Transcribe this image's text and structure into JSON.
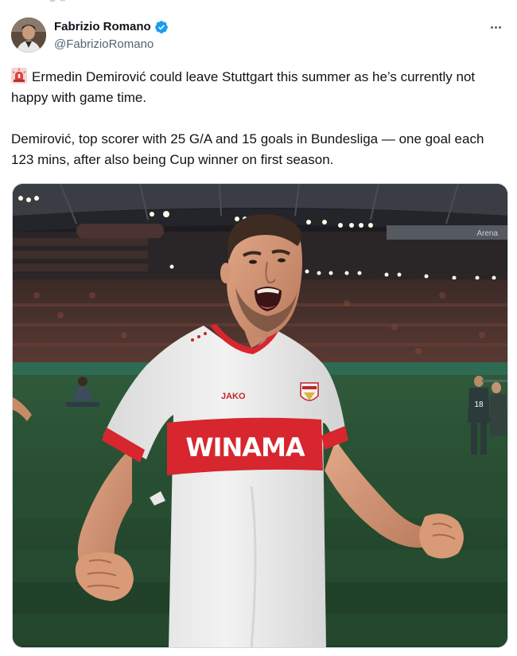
{
  "tweet": {
    "author": {
      "name": "Fabrizio Romano",
      "handle": "@FabrizioRomano",
      "verified": true,
      "avatar_icon": "avatar-photo"
    },
    "more_icon": "more-dots-icon",
    "paragraphs": [
      {
        "emoji": "rotating-light-icon",
        "text": "Ermedin Demirović could leave Stuttgart this summer as he’s currently not happy with game time."
      },
      {
        "text": "Demirović, top scorer with 25 G/A and 15 goals in Bundesliga — one goal each 123 mins, after also being Cup winner on first season."
      }
    ],
    "media": {
      "kit_brand": "JAKO",
      "shirt_sponsor": "WINAMA",
      "stadium_sign": "Arena"
    }
  },
  "colors": {
    "text_primary": "#0f1419",
    "text_secondary": "#536471",
    "verified_blue": "#1d9bf0",
    "kit_red": "#d7262e",
    "siren_red": "#e2413b"
  }
}
